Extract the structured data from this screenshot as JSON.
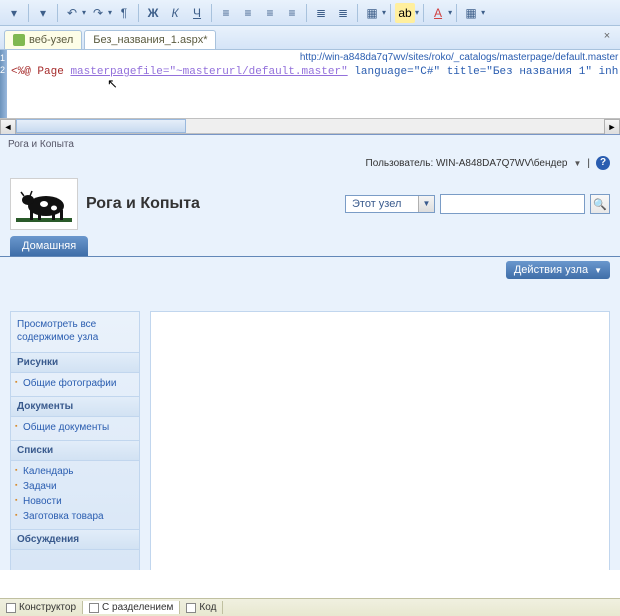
{
  "toolbar": {
    "undo": "↶",
    "redo": "↷",
    "para": "¶",
    "bold": "Ж",
    "italic": "К",
    "underline": "Ч"
  },
  "tabs": [
    {
      "label": "веб-узел",
      "active": false,
      "icon": true
    },
    {
      "label": "Без_названия_1.aspx*",
      "active": true,
      "icon": false
    }
  ],
  "code": {
    "url_hint": "http://win-a848da7q7wv/sites/roko/_catalogs/masterpage/default.master",
    "line1_prefix": "<%@ Page ",
    "line1_attr": "masterpagefile=\"~masterurl/default.master\"",
    "line1_rest": " language=\"C#\" title=\"Без названия 1\" inh",
    "ln1": "1",
    "ln2": "2"
  },
  "preview": {
    "breadcrumb": "Рога и Копыта",
    "user_label": "Пользователь: WIN-A848DA7Q7WV\\бендер",
    "scope": "Этот узел",
    "site_title": "Рога и Копыта",
    "home_tab": "Домашняя",
    "actions": "Действия узла",
    "view_all": "Просмотреть все содержимое узла",
    "sec_pictures": "Рисунки",
    "li_shared_pics": "Общие фотографии",
    "sec_docs": "Документы",
    "li_shared_docs": "Общие документы",
    "sec_lists": "Списки",
    "li_calendar": "Календарь",
    "li_tasks": "Задачи",
    "li_news": "Новости",
    "li_stock": "Заготовка товара",
    "sec_discuss": "Обсуждения"
  },
  "status": {
    "designer": "Конструктор",
    "split": "С разделением",
    "code": "Код"
  }
}
